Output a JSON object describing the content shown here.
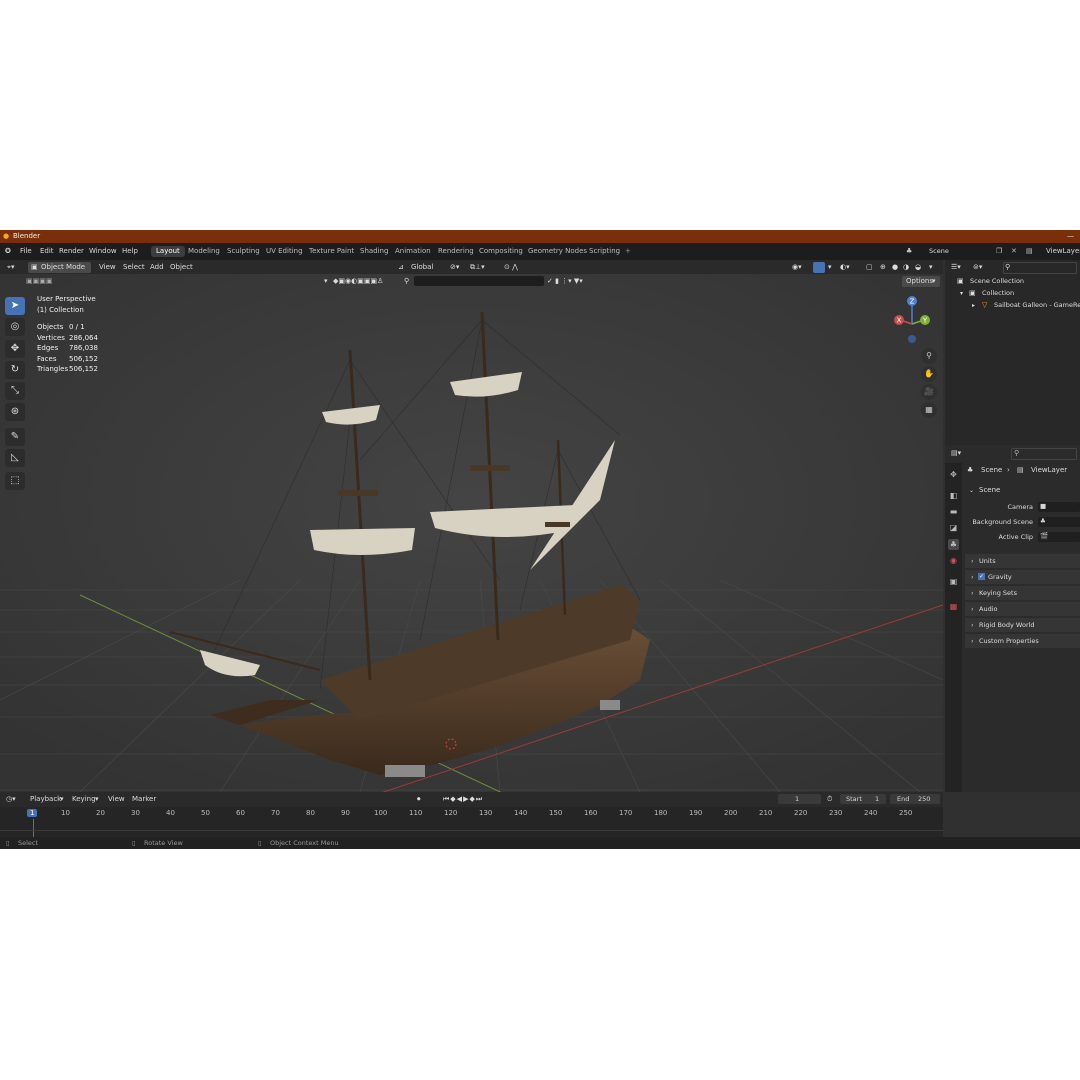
{
  "window": {
    "title": "Blender"
  },
  "menu": {
    "items": [
      "File",
      "Edit",
      "Render",
      "Window",
      "Help"
    ]
  },
  "workspaces": [
    "Layout",
    "Modeling",
    "Sculpting",
    "UV Editing",
    "Texture Paint",
    "Shading",
    "Animation",
    "Rendering",
    "Compositing",
    "Geometry Nodes",
    "Scripting"
  ],
  "active_workspace": "Layout",
  "scene_field": "Scene",
  "viewlayer_field": "ViewLayer",
  "viewport_header": {
    "mode": "Object Mode",
    "menus": [
      "View",
      "Select",
      "Add",
      "Object"
    ],
    "orientation": "Global",
    "options": "Options"
  },
  "overlay_text": {
    "view_name": "User Perspective",
    "collection": "(1) Collection",
    "stats": [
      {
        "label": "Objects",
        "value": "0 / 1"
      },
      {
        "label": "Vertices",
        "value": "286,064"
      },
      {
        "label": "Edges",
        "value": "786,038"
      },
      {
        "label": "Faces",
        "value": "506,152"
      },
      {
        "label": "Triangles",
        "value": "506,152"
      }
    ]
  },
  "gizmo_axes": {
    "z": "Z",
    "y": "Y",
    "x": "X"
  },
  "outliner": {
    "root": "Scene Collection",
    "collection": "Collection",
    "object": "Sailboat Galleon - GameReady"
  },
  "properties": {
    "breadcrumb_scene": "Scene",
    "breadcrumb_viewlayer": "ViewLayer",
    "section": "Scene",
    "fields": [
      {
        "label": "Camera"
      },
      {
        "label": "Background Scene"
      },
      {
        "label": "Active Clip"
      }
    ],
    "panels": [
      "Units",
      "Gravity",
      "Keying Sets",
      "Audio",
      "Rigid Body World",
      "Custom Properties"
    ]
  },
  "timeline": {
    "menus": [
      "Playback",
      "Keying",
      "View",
      "Marker"
    ],
    "current_frame": "1",
    "start_label": "Start",
    "start_value": "1",
    "end_label": "End",
    "end_value": "250",
    "frame_marks": [
      "1",
      "10",
      "20",
      "30",
      "40",
      "50",
      "60",
      "70",
      "80",
      "90",
      "100",
      "110",
      "120",
      "130",
      "140",
      "150",
      "160",
      "170",
      "180",
      "190",
      "200",
      "210",
      "220",
      "230",
      "240",
      "250"
    ]
  },
  "statusbar": {
    "select": "Select",
    "rotate": "Rotate View",
    "context": "Object Context Menu"
  }
}
